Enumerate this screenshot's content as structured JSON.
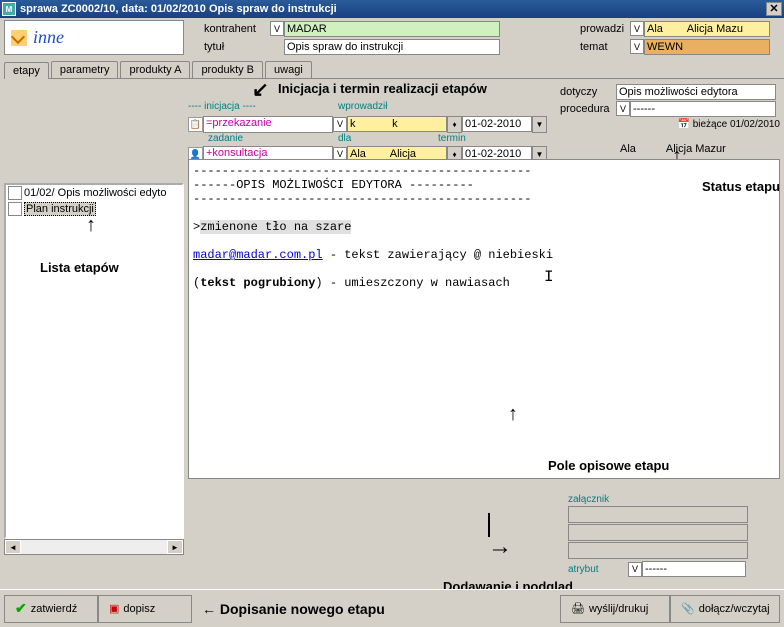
{
  "titlebar": {
    "title": "sprawa  ZC0002/10,  data:  01/02/2010  Opis spraw do instrukcji",
    "close": "✕"
  },
  "header": {
    "inne": "inne",
    "kontrahent_label": "kontrahent",
    "kontrahent_value": "MADAR",
    "tytul_label": "tytuł",
    "tytul_value": "Opis spraw do instrukcji",
    "prowadzi_label": "prowadzi",
    "prowadzi_value": "Ala        Alicja Mazu",
    "temat_label": "temat",
    "temat_value": "WEWN"
  },
  "tabs": [
    "etapy",
    "parametry",
    "produkty A",
    "produkty B",
    "uwagi"
  ],
  "annotations": {
    "top": "Inicjacja i termin realizacji etapów",
    "left": "Lista etapów",
    "status": "Status etapu",
    "field": "Pole opisowe etapu",
    "attach": "Dodawanie i podgląd załączników",
    "footer": "← Dopisanie nowego etapu"
  },
  "stage": {
    "inicjacja_h": "---- inicjacja ----",
    "wprowadzil_h": "wprowadził",
    "dotyczy_label": "dotyczy",
    "dotyczy_value": "Opis możliwości edytora",
    "procedura_label": "procedura",
    "procedura_value": "------",
    "przekazanie": "=przekazanie",
    "k_value": "k            k",
    "date1": "01-02-2010",
    "biezace": "bieżące 01/02/2010",
    "zadanie_h": "zadanie",
    "dla_h": "dla",
    "termin_h": "termin",
    "konsultacja": "+konsultacja",
    "ala_value": "Ala        Alicja",
    "date2": "01-02-2010",
    "ala_text": "Ala",
    "alicja_text": "Alicja Mazur"
  },
  "editor": {
    "line_dash1": "-----------------------------------------------",
    "line_title1": "------OPIS MOŻLIWOŚCI EDYTORA ---------",
    "line_dash2": "-----------------------------------------------",
    "line_gray_pre": ">",
    "line_gray": "zmienone tło na szare",
    "line_mail": "madar@madar.com.pl",
    "line_mail_rest": " - tekst zawierający @ niebieski",
    "line_bold_pre": "(",
    "line_bold": "tekst pogrubiony",
    "line_bold_post": ") - umieszczony w nawiasach"
  },
  "list": {
    "item1": "01/02/ Opis możliwości edyto",
    "item2": "Plan instrukcji"
  },
  "attachment": {
    "zalacznik": "załącznik",
    "atrybut": "atrybut",
    "atrybut_value": "------"
  },
  "footer": {
    "zatwierdz": "zatwierdź",
    "dopisz": "dopisz",
    "wyslij": "wyślij/drukuj",
    "dolacz": "dołącz/wczytaj"
  }
}
